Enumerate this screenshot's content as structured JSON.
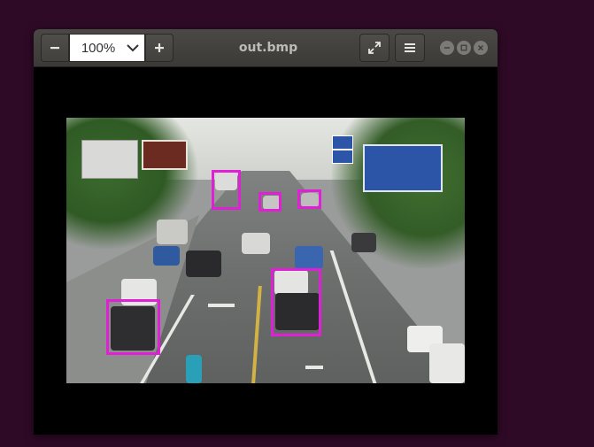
{
  "window": {
    "title": "out.bmp"
  },
  "toolbar": {
    "zoom_out_icon": "minus-icon",
    "zoom_value": "100%",
    "zoom_dropdown_icon": "chevron-down-icon",
    "zoom_in_icon": "plus-icon",
    "fullscreen_icon": "fullscreen-icon",
    "menu_icon": "hamburger-menu-icon"
  },
  "window_controls": [
    "minimize-icon",
    "maximize-icon",
    "close-icon"
  ],
  "image": {
    "description_icon": "street-photo",
    "detections_count": 5
  },
  "colors": {
    "desktop": "#2f0a26",
    "headerbar": "#3b3a37",
    "detection_box": "#e01fd6"
  }
}
